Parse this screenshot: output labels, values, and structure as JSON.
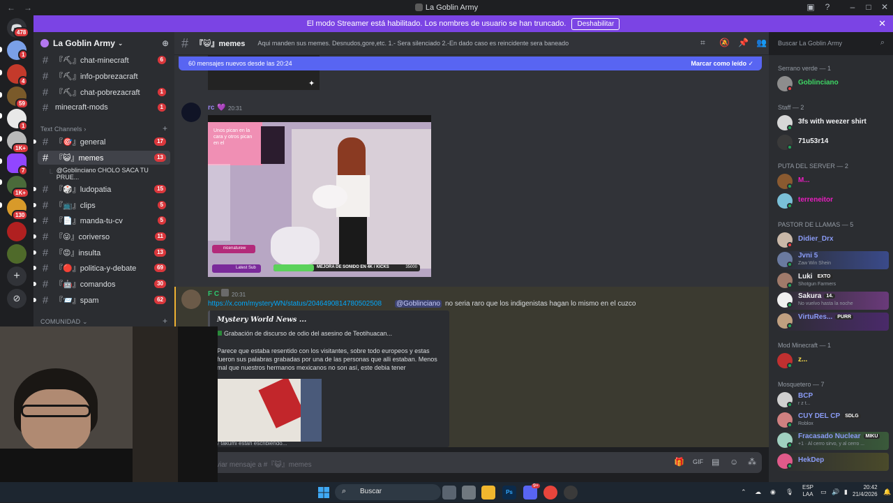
{
  "window": {
    "title": "La Goblin Army",
    "back_glyph": "←",
    "forward_glyph": "→"
  },
  "banner": {
    "text": "El modo Streamer está habilitado. Los nombres de usuario se han truncado.",
    "button_label": "Deshabilitar",
    "close_glyph": "✕"
  },
  "rail": {
    "badges": [
      "478",
      "1",
      "4",
      "59",
      "1",
      "1K+",
      "7",
      "1K+",
      "130"
    ]
  },
  "server": {
    "name": "La Goblin Army",
    "chevron": "⌄"
  },
  "channels": {
    "top": [
      {
        "name": "『⛏』chat-minecraft",
        "count": "6"
      },
      {
        "name": "『⛏』info-pobrezacraft",
        "count": ""
      },
      {
        "name": "『⛏』chat-pobrezacraft",
        "count": "1"
      },
      {
        "name": "minecraft-mods",
        "count": "1"
      }
    ],
    "category_text": "Text Channels",
    "category_chevron": "›",
    "text": [
      {
        "name": "『🎯』general",
        "count": "17"
      },
      {
        "name": "『😺』memes",
        "count": "13"
      },
      {
        "name": "『🎲』ludopatia",
        "count": "15"
      },
      {
        "name": "『📺』clips",
        "count": "5"
      },
      {
        "name": "『📄』manda-tu-cv",
        "count": "5"
      },
      {
        "name": "『😜』coriverso",
        "count": "11"
      },
      {
        "name": "『😡』insulta",
        "count": "13"
      },
      {
        "name": "『🔴』politica-y-debate",
        "count": "69"
      },
      {
        "name": "『🤖』comandos",
        "count": "30"
      },
      {
        "name": "『📨』spam",
        "count": "62"
      }
    ],
    "thread": "@Goblinciano CHOLO SACA TU PRUE...",
    "community_label": "COMUNIDAD",
    "community_chevron": "⌄",
    "plus": "+"
  },
  "header": {
    "channel_name": "『😺』memes",
    "topic": "Aqui manden sus memes. Desnudos,gore,etc. 1.- Sera silenciado 2.-En dado caso es reincidente sera baneado",
    "search_placeholder": "Buscar La Goblin Army"
  },
  "chat": {
    "new_messages": "60 mensajes nuevos desde las 20:24",
    "mark_read": "Marcar como leído",
    "msg1": {
      "user": "rc",
      "time": "20:31"
    },
    "video_overlay": {
      "tweet": "Unos pican en la cara y otros pican en el",
      "follower": "nicenaturew",
      "latest": "Latest Sub",
      "bottom": "MEJORA DE SONIDO EN 4K / KICKS",
      "goal": "35000"
    },
    "msg2": {
      "user": "F C",
      "time": "20:31",
      "link": "https://x.com/mysteryWN/status/2046490814780502508",
      "mention": "@Goblinciano",
      "text": "no seria raro que los indigenistas hagan lo mismo en el cuzco"
    },
    "embed": {
      "title": "Mystery World News ...",
      "subtitle": "Grabación de discurso de odio del asesino de Teotihuacan...",
      "body": "Parece que estaba resentido con los visitantes, sobre todo europeos y estas fueron sus palabras grabadas por una de las personas que alli estaban. Menos mal que nuestros hermanos mexicanos no son así, este debia tener"
    },
    "typing_user": "takumi",
    "typing_text": "y takumi están escribiendo...",
    "composer_placeholder": "viar mensaje a #『😺』memes"
  },
  "members": {
    "groups": [
      {
        "label": "Serrano verde — 1"
      },
      {
        "label": "Staff — 2"
      },
      {
        "label": "PUTA DEL SERVER — 2"
      },
      {
        "label": "PASTOR DE LLAMAS — 5"
      },
      {
        "label": "Mod Minecraft — 1"
      },
      {
        "label": "Mosquetero — 7"
      }
    ],
    "list": [
      {
        "name": "Goblinciano",
        "sub": "",
        "tag": ""
      },
      {
        "name": "3fs with weezer shirt",
        "sub": "",
        "tag": ""
      },
      {
        "name": "71u53r14",
        "sub": "",
        "tag": ""
      },
      {
        "name": "M...",
        "sub": "",
        "tag": ""
      },
      {
        "name": "terreneitor",
        "sub": "",
        "tag": ""
      },
      {
        "name": "Didier_Drx",
        "sub": "",
        "tag": ""
      },
      {
        "name": "Jvni 5",
        "sub": "Zaw Win Shein",
        "tag": ""
      },
      {
        "name": "Luki",
        "sub": "Shotgun Farmers",
        "tag": "EXTO"
      },
      {
        "name": "Sakura",
        "sub": "No vuelvo hasta la noche",
        "tag": "14."
      },
      {
        "name": "VirtuRes...",
        "sub": "",
        "tag": "PURR"
      },
      {
        "name": "z...",
        "sub": "",
        "tag": ""
      },
      {
        "name": "BCP",
        "sub": "r z t...",
        "tag": ""
      },
      {
        "name": "CUY DEL CP",
        "sub": "Roblox",
        "tag": "SDLG"
      },
      {
        "name": "Fracasado Nuclear",
        "sub": "+1 · Al cerro sirvo, y al cerro ...",
        "tag": "MIKU"
      },
      {
        "name": "HekDep",
        "sub": "",
        "tag": ""
      }
    ]
  },
  "taskbar": {
    "search": "Buscar",
    "lang_top": "ESP",
    "lang_bottom": "LAA",
    "time": "20:42",
    "date": "21/4/2026",
    "discord_badge": "9+"
  },
  "colors": {
    "accent": "#5865f2",
    "banner": "#7b44e4",
    "online": "#23a55a",
    "dnd": "#f23f43",
    "idle": "#f0b232",
    "badge": "#da373c"
  }
}
